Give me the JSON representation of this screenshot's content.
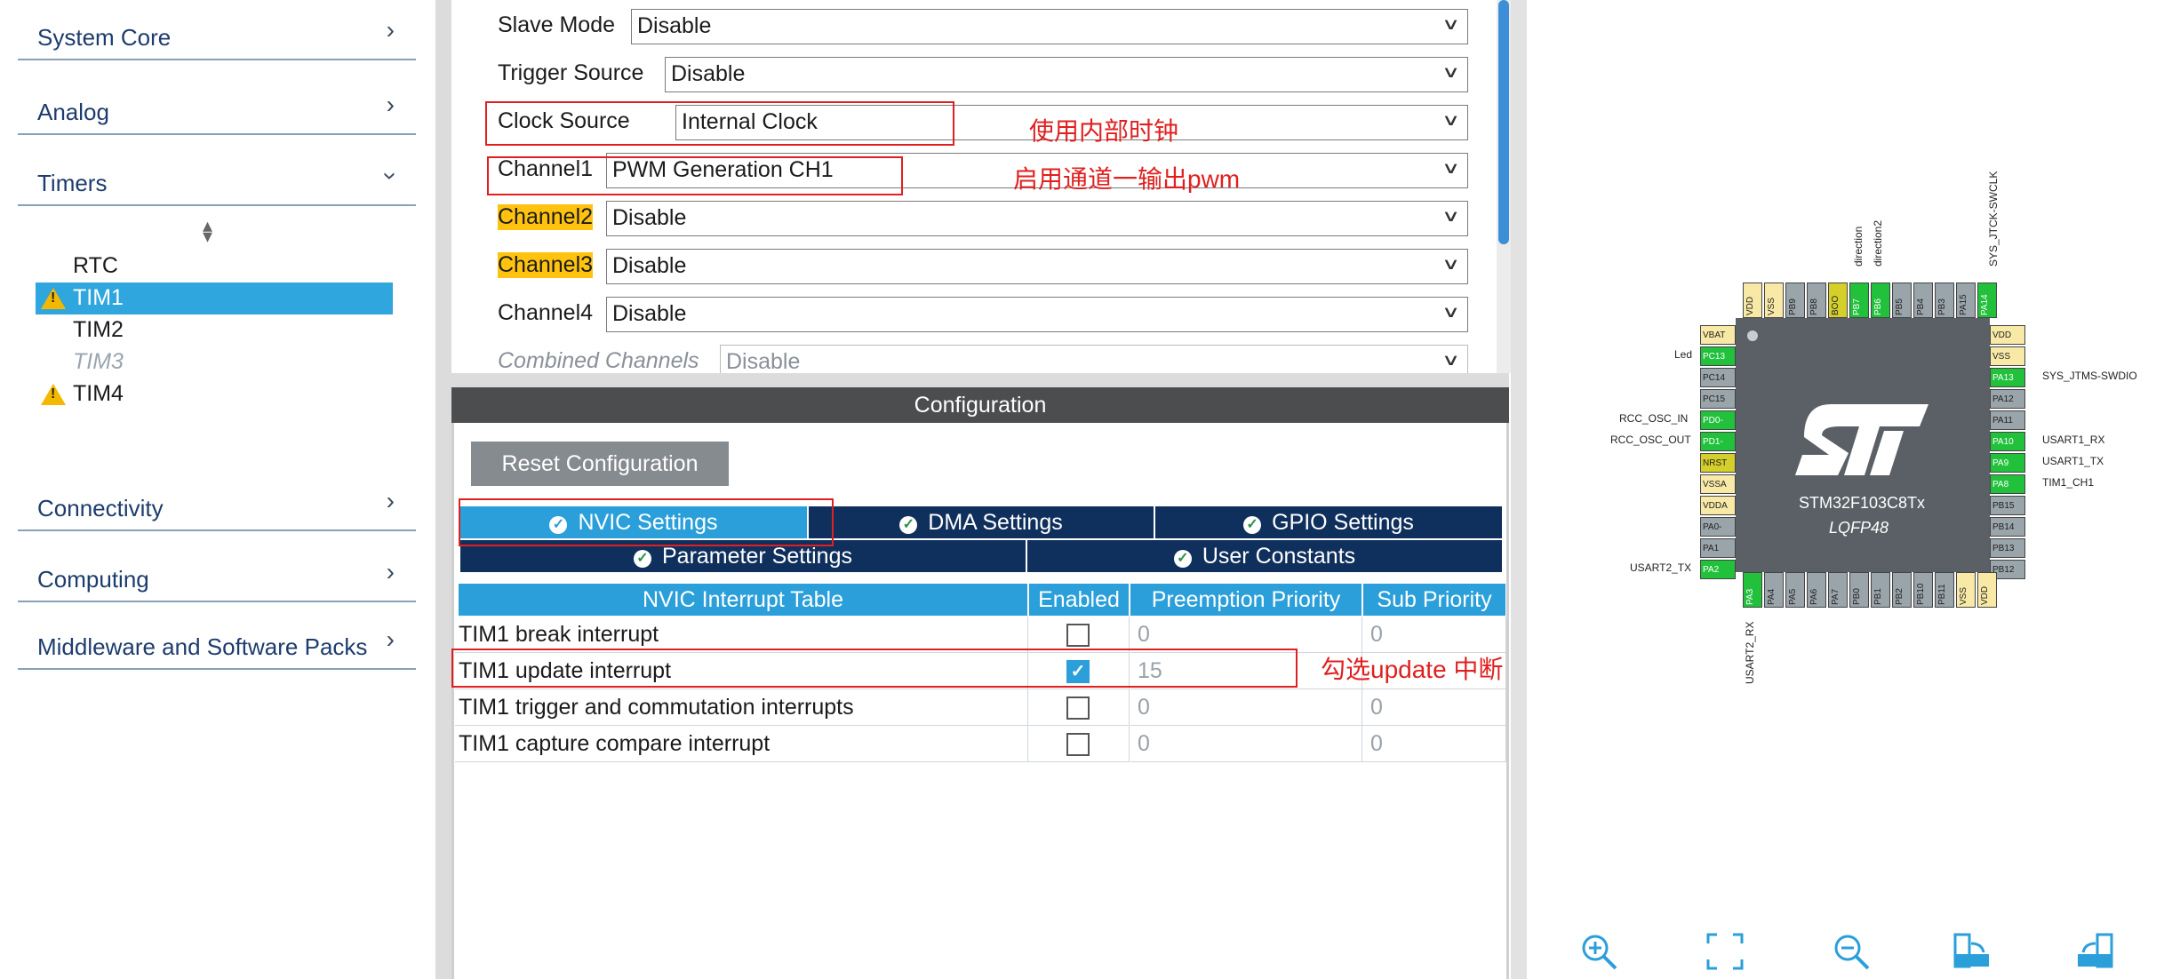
{
  "sidebar": {
    "categories": [
      {
        "label": "System Core"
      },
      {
        "label": "Analog"
      },
      {
        "label": "Timers"
      },
      {
        "label": "Connectivity"
      },
      {
        "label": "Computing"
      },
      {
        "label": "Middleware and Software Packs"
      }
    ],
    "timers": [
      {
        "label": "RTC",
        "state": "normal"
      },
      {
        "label": "TIM1",
        "state": "selected-warning"
      },
      {
        "label": "TIM2",
        "state": "normal"
      },
      {
        "label": "TIM3",
        "state": "disabled"
      },
      {
        "label": "TIM4",
        "state": "warning"
      }
    ]
  },
  "mode": {
    "rows": [
      {
        "label": "Slave Mode",
        "value": "Disable"
      },
      {
        "label": "Trigger Source",
        "value": "Disable"
      },
      {
        "label": "Clock Source",
        "value": "Internal Clock"
      },
      {
        "label": "Channel1",
        "value": "PWM Generation CH1"
      },
      {
        "label": "Channel2",
        "value": "Disable"
      },
      {
        "label": "Channel3",
        "value": "Disable"
      },
      {
        "label": "Channel4",
        "value": "Disable"
      },
      {
        "label": "Combined Channels",
        "value": "Disable"
      }
    ]
  },
  "annotations": {
    "clock": "使用内部时钟",
    "channel": "启用通道一输出pwm",
    "update": "勾选update 中断"
  },
  "config": {
    "title": "Configuration",
    "reset_label": "Reset Configuration",
    "tabs": {
      "nvic": "NVIC Settings",
      "dma": "DMA Settings",
      "gpio": "GPIO Settings",
      "param": "Parameter Settings",
      "user": "User Constants"
    },
    "table": {
      "headers": [
        "NVIC Interrupt Table",
        "Enabled",
        "Preemption Priority",
        "Sub Priority"
      ],
      "rows": [
        {
          "name": "TIM1 break interrupt",
          "enabled": false,
          "preemption": "0",
          "sub": "0"
        },
        {
          "name": "TIM1 update interrupt",
          "enabled": true,
          "preemption": "15",
          "sub": ""
        },
        {
          "name": "TIM1 trigger and commutation interrupts",
          "enabled": false,
          "preemption": "0",
          "sub": "0"
        },
        {
          "name": "TIM1 capture compare interrupt",
          "enabled": false,
          "preemption": "0",
          "sub": "0"
        }
      ]
    }
  },
  "chip": {
    "name": "STM32F103C8Tx",
    "package": "LQFP48",
    "left_pins": [
      "VBAT",
      "PC13",
      "PC14",
      "PC15",
      "PD0-",
      "PD1-",
      "NRST",
      "VSSA",
      "VDDA",
      "PA0-",
      "PA1",
      "PA2"
    ],
    "right_pins": [
      "VDD",
      "VSS",
      "PA13",
      "PA12",
      "PA11",
      "PA10",
      "PA9",
      "PA8",
      "PB15",
      "PB14",
      "PB13",
      "PB12"
    ],
    "top_pins": [
      "VDD",
      "VSS",
      "PB9",
      "PB8",
      "BOO",
      "PB7",
      "PB6",
      "PB5",
      "PB4",
      "PB3",
      "PA15",
      "PA14"
    ],
    "bottom_pins": [
      "PA3",
      "PA4",
      "PA5",
      "PA6",
      "PA7",
      "PB0",
      "PB1",
      "PB2",
      "PB10",
      "PB11",
      "VSS",
      "VDD"
    ],
    "labels": {
      "led": "Led",
      "osc_in": "RCC_OSC_IN",
      "osc_out": "RCC_OSC_OUT",
      "usart2_tx": "USART2_TX",
      "usart2_rx": "USART2_RX",
      "swdio": "SYS_JTMS-SWDIO",
      "usart1_rx": "USART1_RX",
      "usart1_tx": "USART1_TX",
      "tim1_ch1": "TIM1_CH1",
      "swclk": "SYS_JTCK-SWCLK",
      "direction": "direction",
      "direction2": "direction2"
    }
  },
  "toolbar": {
    "icons": [
      "zoom-in-icon",
      "fit-screen-icon",
      "zoom-out-icon",
      "export-icon",
      "rotate-icon"
    ]
  },
  "colors": {
    "accent": "#2b9fd9",
    "dark_tab": "#0f2f5c",
    "highlight": "#ffc30f",
    "annotation": "#e02020",
    "pin_active": "#21c13c"
  }
}
